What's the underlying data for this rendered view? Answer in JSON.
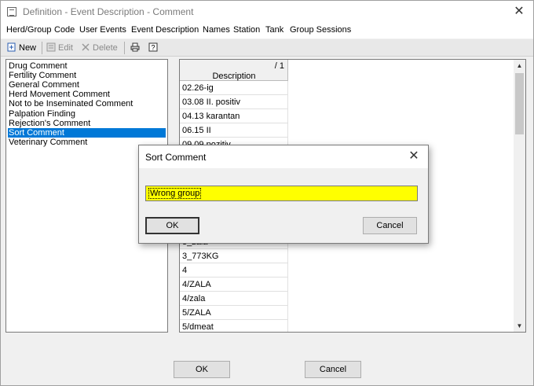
{
  "window": {
    "title": "Definition - Event Description - Comment",
    "close_glyph": "✕"
  },
  "menu": {
    "items": [
      "Herd/Group",
      "Code",
      "User Events",
      "Event Description",
      "Names",
      "Station",
      "Tank",
      "Group Sessions"
    ]
  },
  "toolbar": {
    "new_label": "New",
    "edit_label": "Edit",
    "delete_label": "Delete"
  },
  "list": {
    "items": [
      "Drug Comment",
      "Fertility Comment",
      "General Comment",
      "Herd Movement Comment",
      "Not to be Inseminated Comment",
      "Palpation Finding",
      "Rejection's Comment",
      "Sort Comment",
      "Veterinary Comment"
    ],
    "selected": "Sort Comment"
  },
  "grid": {
    "count": "/ 1",
    "column_header": "Description",
    "rows_top": [
      "02.26-ig",
      "03.08 II. positiv",
      "04.13 karantan",
      "06.15 II",
      "09.09 pozitiv"
    ],
    "rows_bottom": [
      "3_zala",
      "3_773KG",
      "4",
      "4/ZALA",
      "4/zala",
      "5/ZALA",
      "5/dmeat"
    ]
  },
  "dialog": {
    "title": "Sort Comment",
    "close_glyph": "✕",
    "input_value": "Wrong group",
    "ok_label": "OK",
    "cancel_label": "Cancel",
    "input_bg": "#ffff00"
  },
  "footer": {
    "ok_label": "OK",
    "cancel_label": "Cancel"
  },
  "colors": {
    "selection": "#0078d7"
  }
}
